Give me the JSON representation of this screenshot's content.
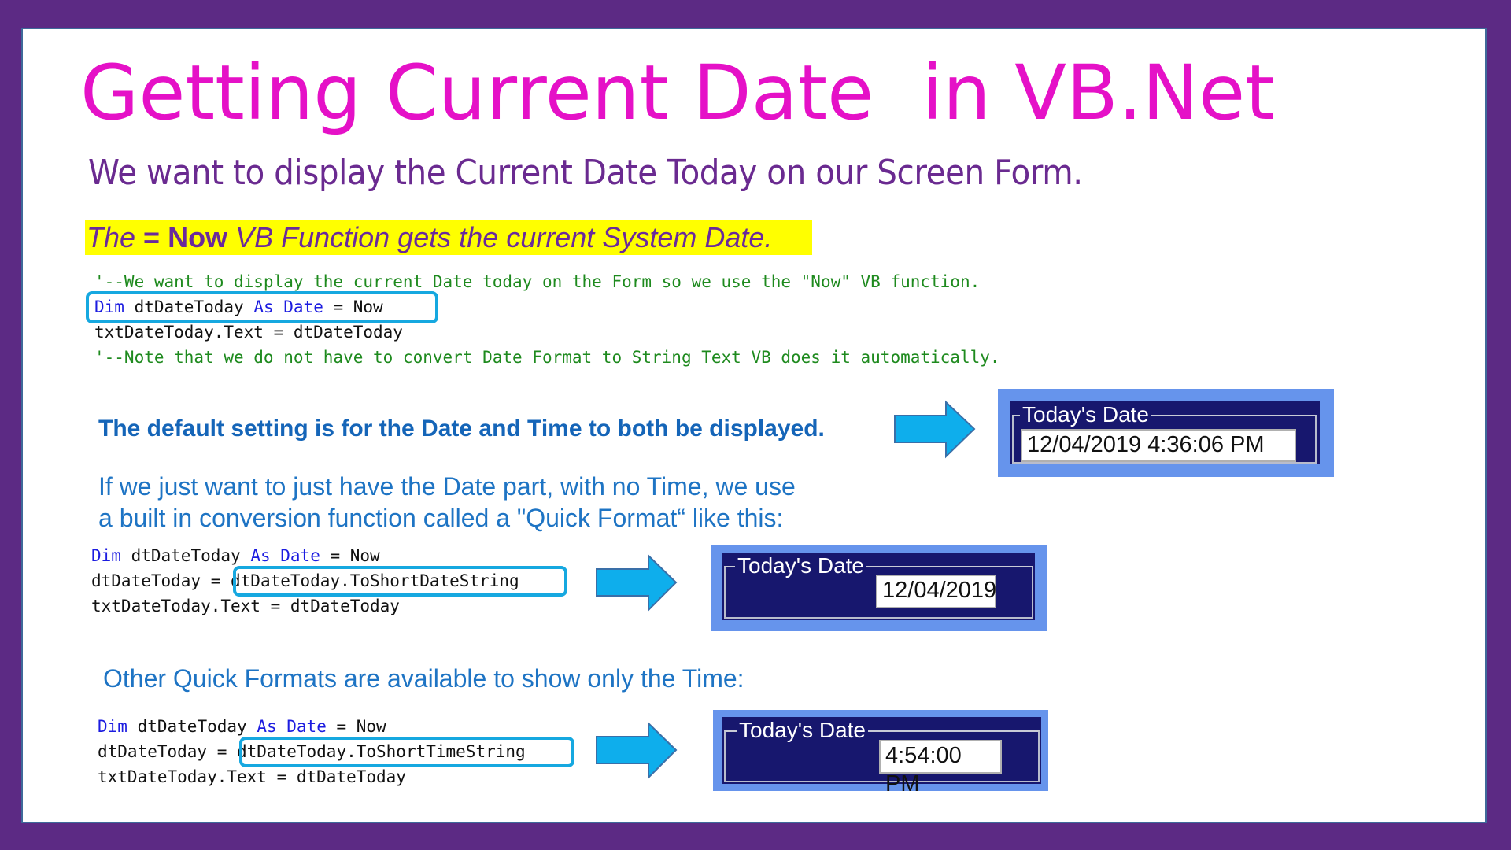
{
  "title": "Getting Current Date  in VB.Net",
  "subtitle": "We want to display the Current Date Today on our Screen Form.",
  "highlight": {
    "prefix": "The ",
    "bold": "= Now",
    "suffix": " VB Function gets the current System Date."
  },
  "code1": {
    "comment1": "'--We want to display the current Date today on the Form so we use the \"Now\" VB function.",
    "line2": {
      "kw1": "Dim",
      "mid1": " dtDateToday ",
      "kw2": "As",
      "sp": " ",
      "kw3": "Date",
      "rest": " = Now"
    },
    "line3": "txtDateToday.Text = dtDateToday",
    "comment2": "'--Note that we do not have to convert Date Format to String Text VB does it automatically."
  },
  "note_default": "The default setting is for the Date and Time to both be displayed.",
  "note_date_only": {
    "line1": "If we just want to just have the Date part, with no Time, we use",
    "line2": "a built in conversion function called a \"Quick Format“ like this:"
  },
  "code2": {
    "line1": {
      "kw1": "Dim",
      "mid1": " dtDateToday ",
      "kw2": "As",
      "sp": " ",
      "kw3": "Date",
      "rest": " = Now"
    },
    "line2_prefix": "dtDateToday = ",
    "line2_boxed": "dtDateToday.ToShortDateString",
    "line3": "txtDateToday.Text = dtDateToday"
  },
  "note_time_only": "Other Quick Formats are available to show only the Time:",
  "code3": {
    "line1": {
      "kw1": "Dim",
      "mid1": " dtDateToday ",
      "kw2": "As",
      "sp": " ",
      "kw3": "Date",
      "rest": " = Now"
    },
    "line2_prefix": "dtDateToday = ",
    "line2_boxed": "dtDateToday.ToShortTimeString",
    "line3": "txtDateToday.Text = dtDateToday"
  },
  "forms": [
    {
      "group_label": "Today's Date",
      "textbox_value": "12/04/2019 4:36:06 PM"
    },
    {
      "group_label": "Today's Date",
      "textbox_value": "12/04/2019"
    },
    {
      "group_label": "Today's Date",
      "textbox_value": "4:54:00 PM"
    }
  ],
  "icons": {
    "arrow": "right-arrow-icon"
  },
  "colors": {
    "frame": "#5c2a84",
    "title": "#e511c7",
    "subtitle": "#6a2a90",
    "highlight_bg": "#ffff00",
    "code_comment": "#1e8a1e",
    "code_keyword": "#1c1ce0",
    "callout_box": "#16a8e0",
    "note_text": "#1e74c4",
    "arrow_fill": "#0eaeec",
    "form_panel": "#6694ec",
    "form_navy": "#17176e"
  }
}
